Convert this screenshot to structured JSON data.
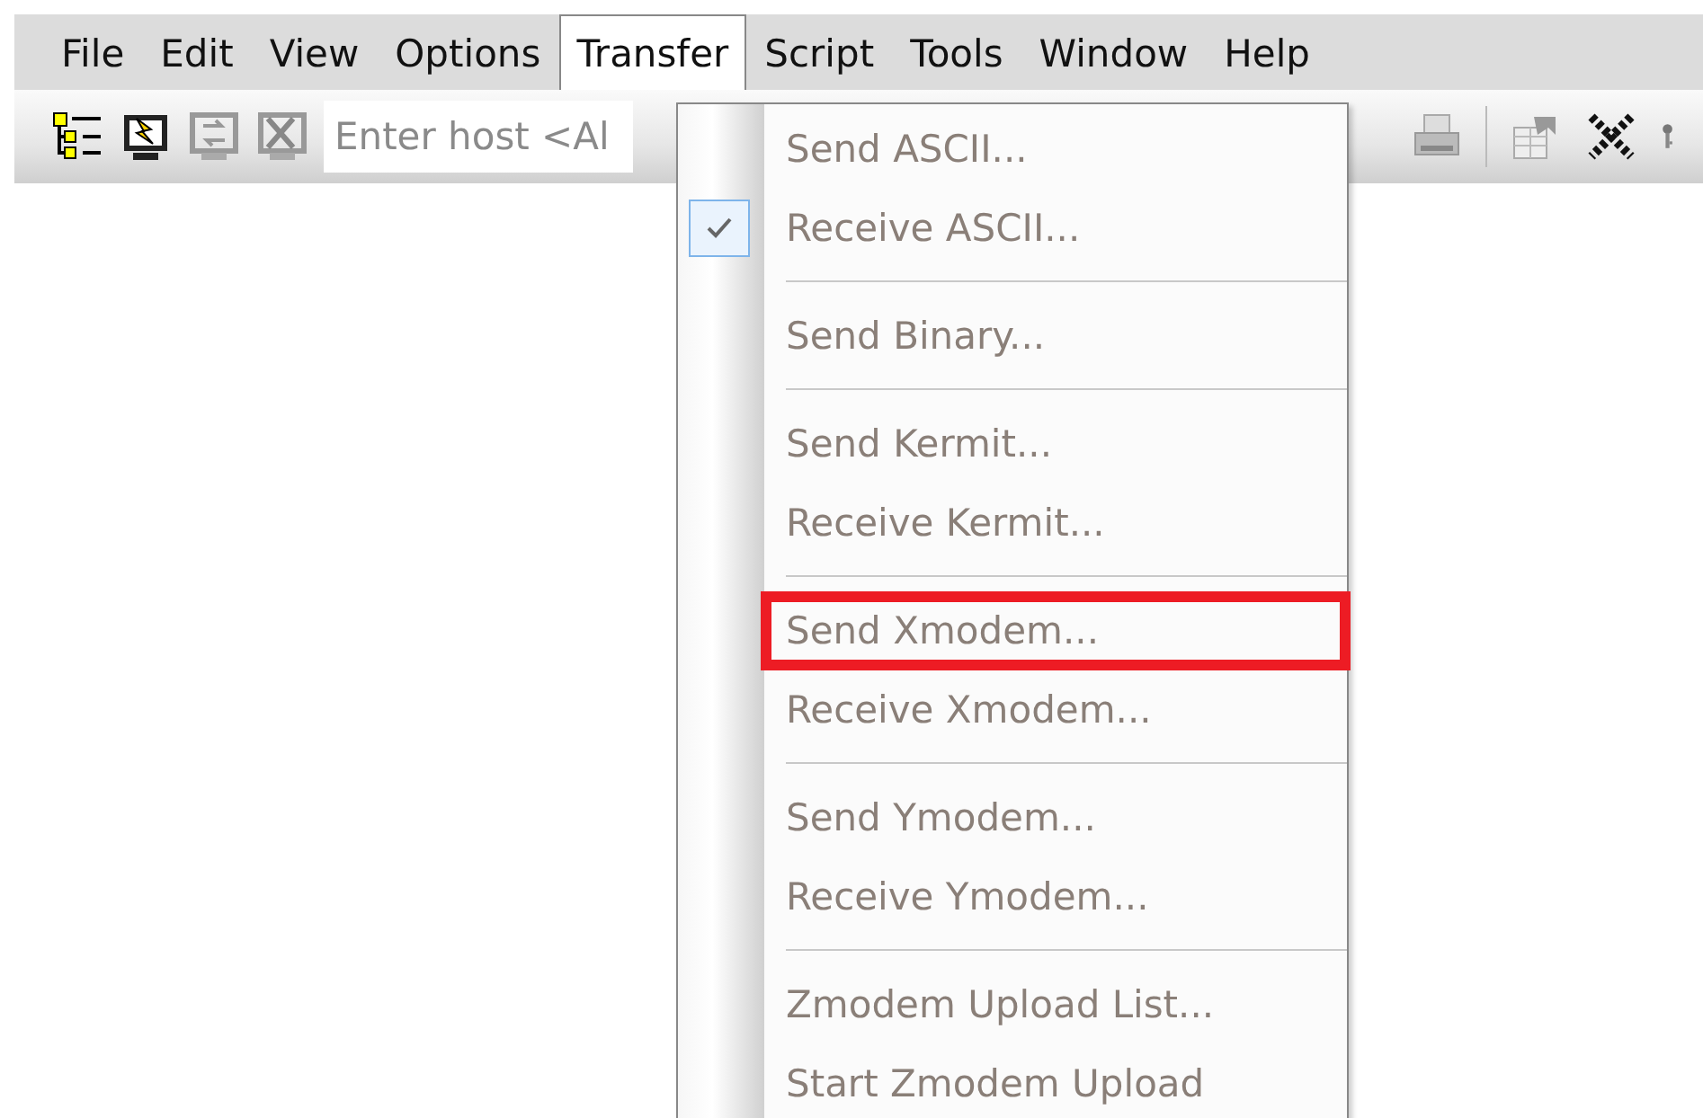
{
  "menu_bar": [
    {
      "label": "File",
      "selected": false
    },
    {
      "label": "Edit",
      "selected": false
    },
    {
      "label": "View",
      "selected": false
    },
    {
      "label": "Options",
      "selected": false
    },
    {
      "label": "Transfer",
      "selected": true
    },
    {
      "label": "Script",
      "selected": false
    },
    {
      "label": "Tools",
      "selected": false
    },
    {
      "label": "Window",
      "selected": false
    },
    {
      "label": "Help",
      "selected": false
    }
  ],
  "toolbar": {
    "host_field": {
      "placeholder": "Enter host <Al"
    }
  },
  "transfer_menu": [
    {
      "kind": "item",
      "label": "Send ASCII...",
      "checked": false,
      "highlighted": false
    },
    {
      "kind": "item",
      "label": "Receive ASCII...",
      "checked": true,
      "highlighted": false
    },
    {
      "kind": "separator"
    },
    {
      "kind": "item",
      "label": "Send Binary...",
      "checked": false,
      "highlighted": false
    },
    {
      "kind": "separator"
    },
    {
      "kind": "item",
      "label": "Send Kermit...",
      "checked": false,
      "highlighted": false
    },
    {
      "kind": "item",
      "label": "Receive Kermit...",
      "checked": false,
      "highlighted": false
    },
    {
      "kind": "separator"
    },
    {
      "kind": "item",
      "label": "Send Xmodem...",
      "checked": false,
      "highlighted": true
    },
    {
      "kind": "item",
      "label": "Receive Xmodem...",
      "checked": false,
      "highlighted": false
    },
    {
      "kind": "separator"
    },
    {
      "kind": "item",
      "label": "Send Ymodem...",
      "checked": false,
      "highlighted": false
    },
    {
      "kind": "item",
      "label": "Receive Ymodem...",
      "checked": false,
      "highlighted": false
    },
    {
      "kind": "separator"
    },
    {
      "kind": "item",
      "label": "Zmodem Upload List...",
      "checked": false,
      "highlighted": false
    },
    {
      "kind": "item",
      "label": "Start Zmodem Upload",
      "checked": false,
      "highlighted": false
    }
  ]
}
